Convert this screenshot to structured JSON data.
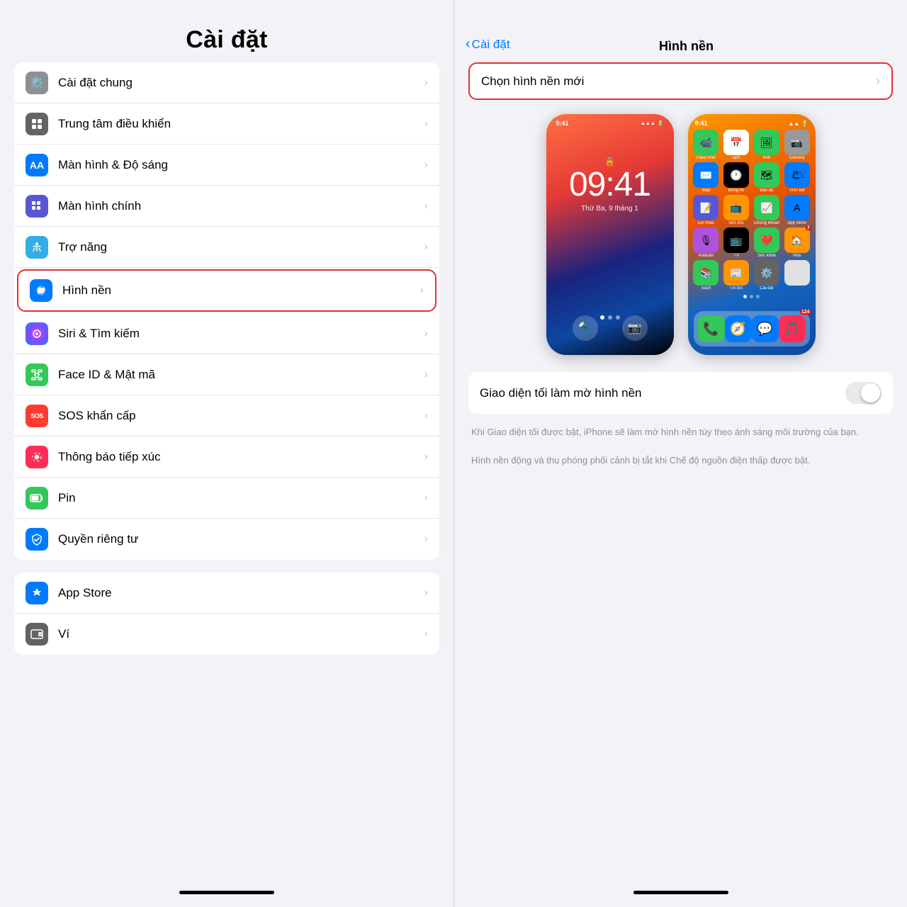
{
  "left": {
    "title": "Cài đặt",
    "groups": [
      {
        "items": [
          {
            "id": "cai-dat-chung",
            "icon": "⚙️",
            "iconBg": "icon-gray",
            "label": "Cài đặt chung"
          },
          {
            "id": "trung-tam-dieu-khien",
            "icon": "🎛",
            "iconBg": "icon-gray2",
            "label": "Trung tâm điều khiển"
          },
          {
            "id": "man-hinh-do-sang",
            "icon": "AA",
            "iconBg": "icon-blue",
            "label": "Màn hình & Độ sáng"
          },
          {
            "id": "man-hinh-chinh",
            "icon": "🔲",
            "iconBg": "icon-blue2",
            "label": "Màn hình chính"
          },
          {
            "id": "tro-nang",
            "icon": "♿",
            "iconBg": "icon-blue3",
            "label": "Trợ năng"
          },
          {
            "id": "hinh-nen",
            "icon": "✿",
            "iconBg": "icon-blue",
            "label": "Hình nền",
            "highlighted": true
          },
          {
            "id": "siri-tim-kiem",
            "icon": "🎙",
            "iconBg": "icon-gray",
            "label": "Siri & Tìm kiếm"
          },
          {
            "id": "face-id",
            "icon": "🙂",
            "iconBg": "icon-green",
            "label": "Face ID & Mật mã"
          },
          {
            "id": "sos",
            "icon": "SOS",
            "iconBg": "icon-red",
            "label": "SOS khẩn cấp"
          },
          {
            "id": "thong-bao-tiep-xuc",
            "icon": "📡",
            "iconBg": "icon-pink",
            "label": "Thông báo tiếp xúc"
          },
          {
            "id": "pin",
            "icon": "🔋",
            "iconBg": "icon-green",
            "label": "Pin"
          },
          {
            "id": "quyen-rieng-tu",
            "icon": "✋",
            "iconBg": "icon-blue",
            "label": "Quyền riêng tư"
          }
        ]
      },
      {
        "items": [
          {
            "id": "app-store",
            "icon": "🅐",
            "iconBg": "icon-blue",
            "label": "App Store"
          },
          {
            "id": "vi",
            "icon": "💳",
            "iconBg": "icon-gray2",
            "label": "Ví"
          }
        ]
      }
    ]
  },
  "right": {
    "back_label": "Cài đặt",
    "title": "Hình nền",
    "choose_label": "Chọn hình nền mới",
    "toggle_label": "Giao diện tối làm mờ hình nền",
    "description1": "Khi Giao diện tối được bật, iPhone sẽ làm mờ hình nền tùy theo ánh sáng môi trường của bạn.",
    "description2": "Hình nền động và thu phóng phối cảnh bị tắt khi Chế độ nguồn điện thấp được bật.",
    "lock_time": "09:41",
    "lock_date": "Thứ Ba, 9 tháng 1"
  }
}
